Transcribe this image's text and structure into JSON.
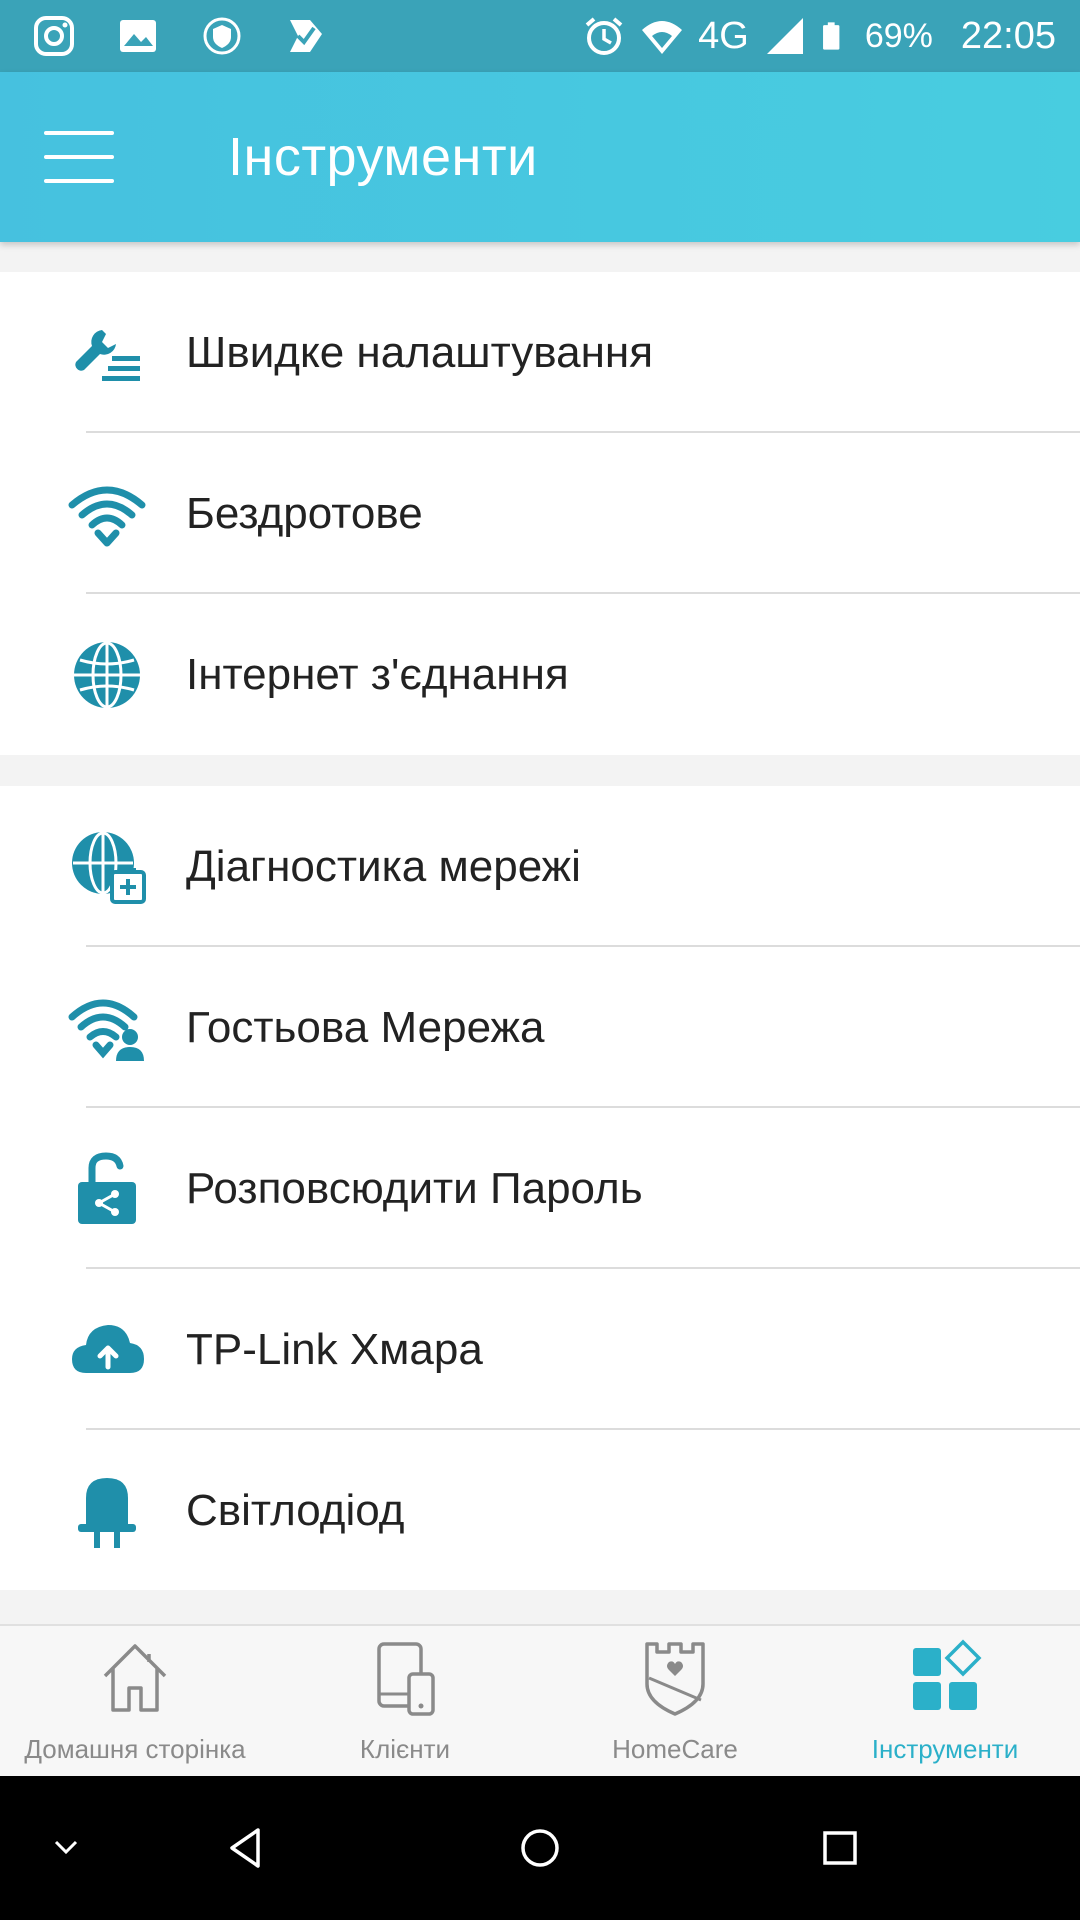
{
  "status_bar": {
    "network": "4G",
    "battery": "69%",
    "time": "22:05"
  },
  "app_bar": {
    "title": "Інструменти"
  },
  "groups": [
    {
      "items": [
        {
          "label": "Швидке налаштування",
          "icon": "quick-setup-icon"
        },
        {
          "label": "Бездротове",
          "icon": "wifi-icon"
        },
        {
          "label": "Інтернет з'єднання",
          "icon": "globe-icon"
        }
      ]
    },
    {
      "items": [
        {
          "label": "Діагностика мережі",
          "icon": "network-diagnostics-icon"
        },
        {
          "label": "Гостьова Мережа",
          "icon": "guest-network-icon"
        },
        {
          "label": "Розповсюдити Пароль",
          "icon": "share-password-icon"
        },
        {
          "label": "TP-Link Хмара",
          "icon": "cloud-icon"
        },
        {
          "label": "Світлодіод",
          "icon": "led-icon"
        }
      ]
    }
  ],
  "bottom_nav": [
    {
      "label": "Домашня сторінка",
      "icon": "home-icon",
      "active": false
    },
    {
      "label": "Клієнти",
      "icon": "clients-icon",
      "active": false
    },
    {
      "label": "HomeCare",
      "icon": "homecare-icon",
      "active": false
    },
    {
      "label": "Інструменти",
      "icon": "tools-icon",
      "active": true
    }
  ],
  "colors": {
    "status_bar": "#3aa3b8",
    "app_bar": "#46c1df",
    "icon_accent": "#1f8faa",
    "active_tab": "#2bb0c9",
    "inactive_tab": "#8a8a8a"
  }
}
